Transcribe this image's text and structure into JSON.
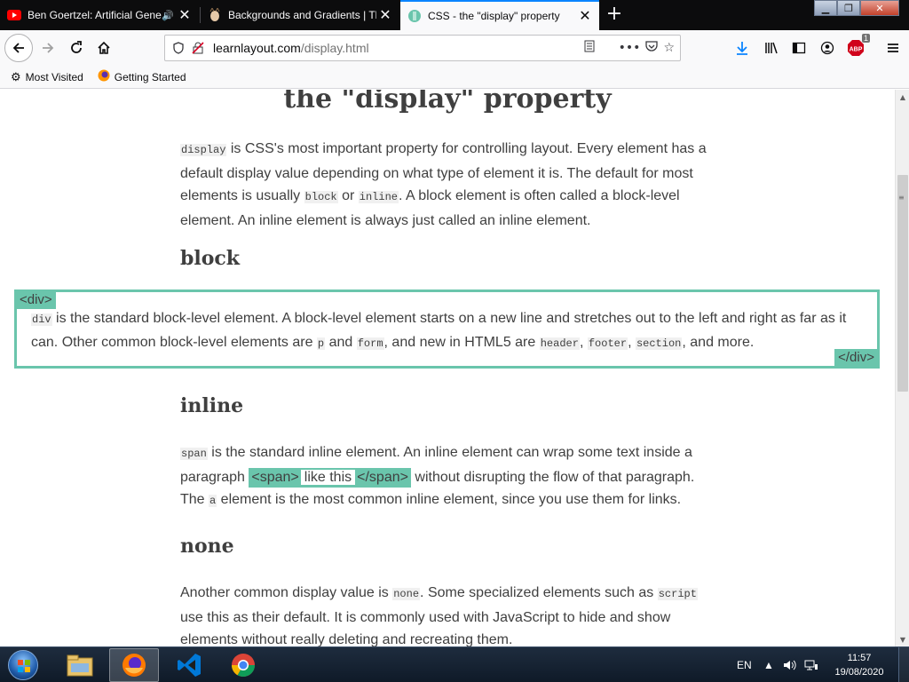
{
  "browser": {
    "tabs": [
      {
        "title": "Ben Goertzel: Artificial General",
        "favicon": "youtube-icon",
        "audio": true
      },
      {
        "title": "Backgrounds and Gradients | Th",
        "favicon": "head-icon"
      },
      {
        "title": "CSS - the \"display\" property",
        "favicon": "learnlayout-icon",
        "active": true
      }
    ],
    "new_tab": "+",
    "url": {
      "domain": "learnlayout.com",
      "path": "/display.html"
    },
    "abp_badge": "1",
    "bookmarks": [
      {
        "label": "Most Visited",
        "icon": "gear-icon"
      },
      {
        "label": "Getting Started",
        "icon": "firefox-icon"
      }
    ]
  },
  "page": {
    "title": "the \"display\" property",
    "intro": {
      "code_display": "display",
      "t1": " is CSS's most important property for controlling layout. Every element has a default display value depending on what type of element it is. The default for most elements is usually ",
      "code_block": "block",
      "t2": " or ",
      "code_inline": "inline",
      "t3": ". A block element is often called a block-level element. An inline element is always just called an inline element."
    },
    "block": {
      "heading": "block",
      "open_tag": "<div>",
      "close_tag": "</div>",
      "code_div": "div",
      "t1": " is the standard block-level element. A block-level element starts on a new line and stretches out to the left and right as far as it can. Other common block-level elements are ",
      "code_p": "p",
      "t2": " and ",
      "code_form": "form",
      "t3": ", and new in HTML5 are ",
      "code_header": "header",
      "sep1": ", ",
      "code_footer": "footer",
      "sep2": ", ",
      "code_section": "section",
      "t4": ", and more."
    },
    "inline": {
      "heading": "inline",
      "code_span": "span",
      "t1": " is the standard inline element. An inline element can wrap some text inside a paragraph ",
      "span_open": "<span>",
      "span_text": "like this",
      "span_close": "</span>",
      "t2": " without disrupting the flow of that paragraph. The ",
      "code_a": "a",
      "t3": " element is the most common inline element, since you use them for links."
    },
    "none": {
      "heading": "none",
      "t1": "Another common display value is ",
      "code_none": "none",
      "t2": ". Some specialized elements such as ",
      "code_script": "script",
      "t3": " use this as their default. It is commonly used with JavaScript to hide and show elements without really deleting and recreating them."
    }
  },
  "taskbar": {
    "apps": [
      {
        "name": "file-explorer-icon"
      },
      {
        "name": "firefox-icon",
        "active": true
      },
      {
        "name": "vscode-icon"
      },
      {
        "name": "chrome-icon"
      }
    ],
    "language": "EN",
    "time": "11:57",
    "date": "19/08/2020"
  },
  "colors": {
    "accent": "#6ac5ac",
    "text": "#3f3f3f",
    "tabstrip": "#0c0c0d",
    "active_tab_line": "#0a84ff"
  }
}
